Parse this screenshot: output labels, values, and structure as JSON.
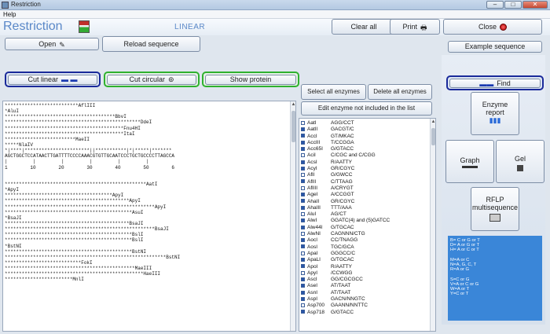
{
  "window": {
    "title": "Restriction",
    "minimize": "–",
    "maximize": "□",
    "close": "✕"
  },
  "menu": {
    "help": "Help"
  },
  "header": {
    "brand": "Restriction",
    "mode": "LINEAR"
  },
  "toolbar": {
    "clear_all": "Clear all",
    "print": "Print",
    "close": "Close"
  },
  "top_buttons": {
    "open": "Open",
    "reload": "Reload sequence",
    "example": "Example sequence"
  },
  "cut_buttons": {
    "cut_linear": "Cut linear",
    "cut_circular": "Cut circular",
    "show_protein": "Show protein"
  },
  "enzyme_buttons": {
    "select_all": "Select all enzymes",
    "delete_all": "Delete all enzymes",
    "edit_not_included": "Edit enzyme not included in the list"
  },
  "right": {
    "find": "Find",
    "enzyme_report": "Enzyme report",
    "graph": "Graph",
    "gel": "Gel",
    "rflp": "RFLP multisequence"
  },
  "legend": [
    "B= C or G or T",
    "D= A or G or T",
    "H= A or C or T",
    "",
    "M=A or C",
    "N=A, G, C, T",
    "R=A or G",
    "",
    "S=C or G",
    "V=A or C or G",
    "W=A or T",
    "Y=C or T"
  ],
  "sequence_lines": [
    "**************************AflIII",
    "*AluI",
    "***************************************BbvI",
    "************************************************DdeI",
    "******************************************Fnu4HI",
    "******************************************ItaI",
    "*************************MaeII",
    "*****NlaIV",
    "*|****|***********************||***********|*|*****|*******",
    "AGCTGGCTCCATAACTTGATTTTCCCCAAACGTGTTGCAATCCCTGCTGCCCCTTAGCCA",
    "|         |         |         |         |         |",
    "1        10        20        30        40        50        6",
    "",
    "",
    "**************************************************AatI",
    "*ApyI",
    "**************************************ApyI",
    "********************************************ApyI",
    "*****************************************************ApyI",
    "*********************************************AsuI",
    "*BsaJI",
    "********************************************BsaJI",
    "*****************************************************BsaJI",
    "*********************************************BslI",
    "*********************************************BslI",
    "*BstNI",
    "*********************************************BstNI",
    "*********************************************************BstNI",
    "***************************FokI",
    "**********************************************MaeIII",
    "*************************************************HaeIII",
    "************************MnlI"
  ],
  "enzymes": [
    {
      "name": "AatI",
      "site": "AGG/CCT",
      "checked": true
    },
    {
      "name": "AatII",
      "site": "GACGT/C",
      "checked": false
    },
    {
      "name": "AccI",
      "site": "GT/MKAC",
      "checked": false
    },
    {
      "name": "AccIII",
      "site": "T/CCGGA",
      "checked": false
    },
    {
      "name": "Acc65I",
      "site": "G/GTACC",
      "checked": false
    },
    {
      "name": "AciI",
      "site": "C/CGC  and  C/CGG",
      "checked": true
    },
    {
      "name": "AcsI",
      "site": "R/AATTY",
      "checked": false
    },
    {
      "name": "AcyI",
      "site": "GR/CGYC",
      "checked": false
    },
    {
      "name": "AflI",
      "site": "G/GWCC",
      "checked": true
    },
    {
      "name": "AflII",
      "site": "C/TTAAG",
      "checked": false
    },
    {
      "name": "AflIII",
      "site": "A/CRYGT",
      "checked": true
    },
    {
      "name": "AgeI",
      "site": "A/CCGGT",
      "checked": false
    },
    {
      "name": "AhaII",
      "site": "GR/CGYC",
      "checked": false
    },
    {
      "name": "AhaIII",
      "site": "TTT/AAA",
      "checked": false
    },
    {
      "name": "AluI",
      "site": "AG/CT",
      "checked": true
    },
    {
      "name": "AlwI",
      "site": "GGATC(4) and (5)GATCC",
      "checked": false
    },
    {
      "name": "Alw44I",
      "site": "G/TGCAC",
      "checked": false
    },
    {
      "name": "AlwNI",
      "site": "CAGNNN/CTG",
      "checked": true
    },
    {
      "name": "AocI",
      "site": "CC/TNAGG",
      "checked": false
    },
    {
      "name": "AosI",
      "site": "TGC/GCA",
      "checked": false
    },
    {
      "name": "ApaI",
      "site": "GGGCC/C",
      "checked": true
    },
    {
      "name": "ApaLI",
      "site": "G/TGCAC",
      "checked": false
    },
    {
      "name": "ApoI",
      "site": "R/AATTY",
      "checked": false
    },
    {
      "name": "ApyI",
      "site": "/CCWGG",
      "checked": true
    },
    {
      "name": "AscI",
      "site": "GG/CGCGCC",
      "checked": false
    },
    {
      "name": "AseI",
      "site": "AT/TAAT",
      "checked": false
    },
    {
      "name": "AsnI",
      "site": "AT/TAAT",
      "checked": false
    },
    {
      "name": "AspI",
      "site": "GACN/NNGTC",
      "checked": false
    },
    {
      "name": "Asp700",
      "site": "GAANN/NNTTC",
      "checked": true
    },
    {
      "name": "Asp718",
      "site": "G/GTACC",
      "checked": false
    }
  ]
}
